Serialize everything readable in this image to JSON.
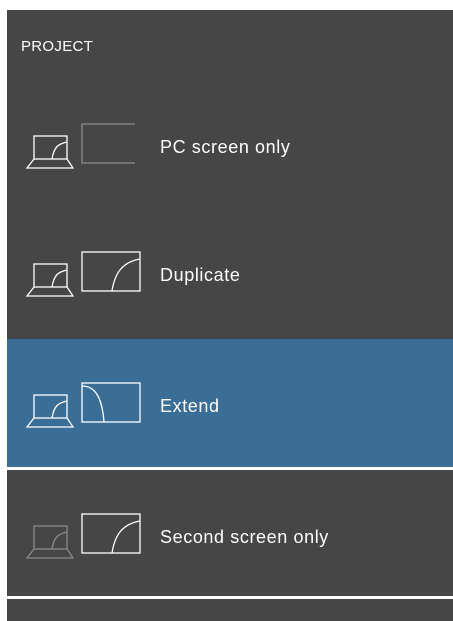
{
  "panel": {
    "title": "PROJECT",
    "options": [
      {
        "label": "PC screen only",
        "icon": "pc-screen-only-icon",
        "selected": false
      },
      {
        "label": "Duplicate",
        "icon": "duplicate-icon",
        "selected": false
      },
      {
        "label": "Extend",
        "icon": "extend-icon",
        "selected": true
      },
      {
        "label": "Second screen only",
        "icon": "second-screen-only-icon",
        "selected": false
      }
    ]
  },
  "colors": {
    "panel_background": "#464646",
    "selected_background": "#3b6e97",
    "text": "#ffffff"
  }
}
